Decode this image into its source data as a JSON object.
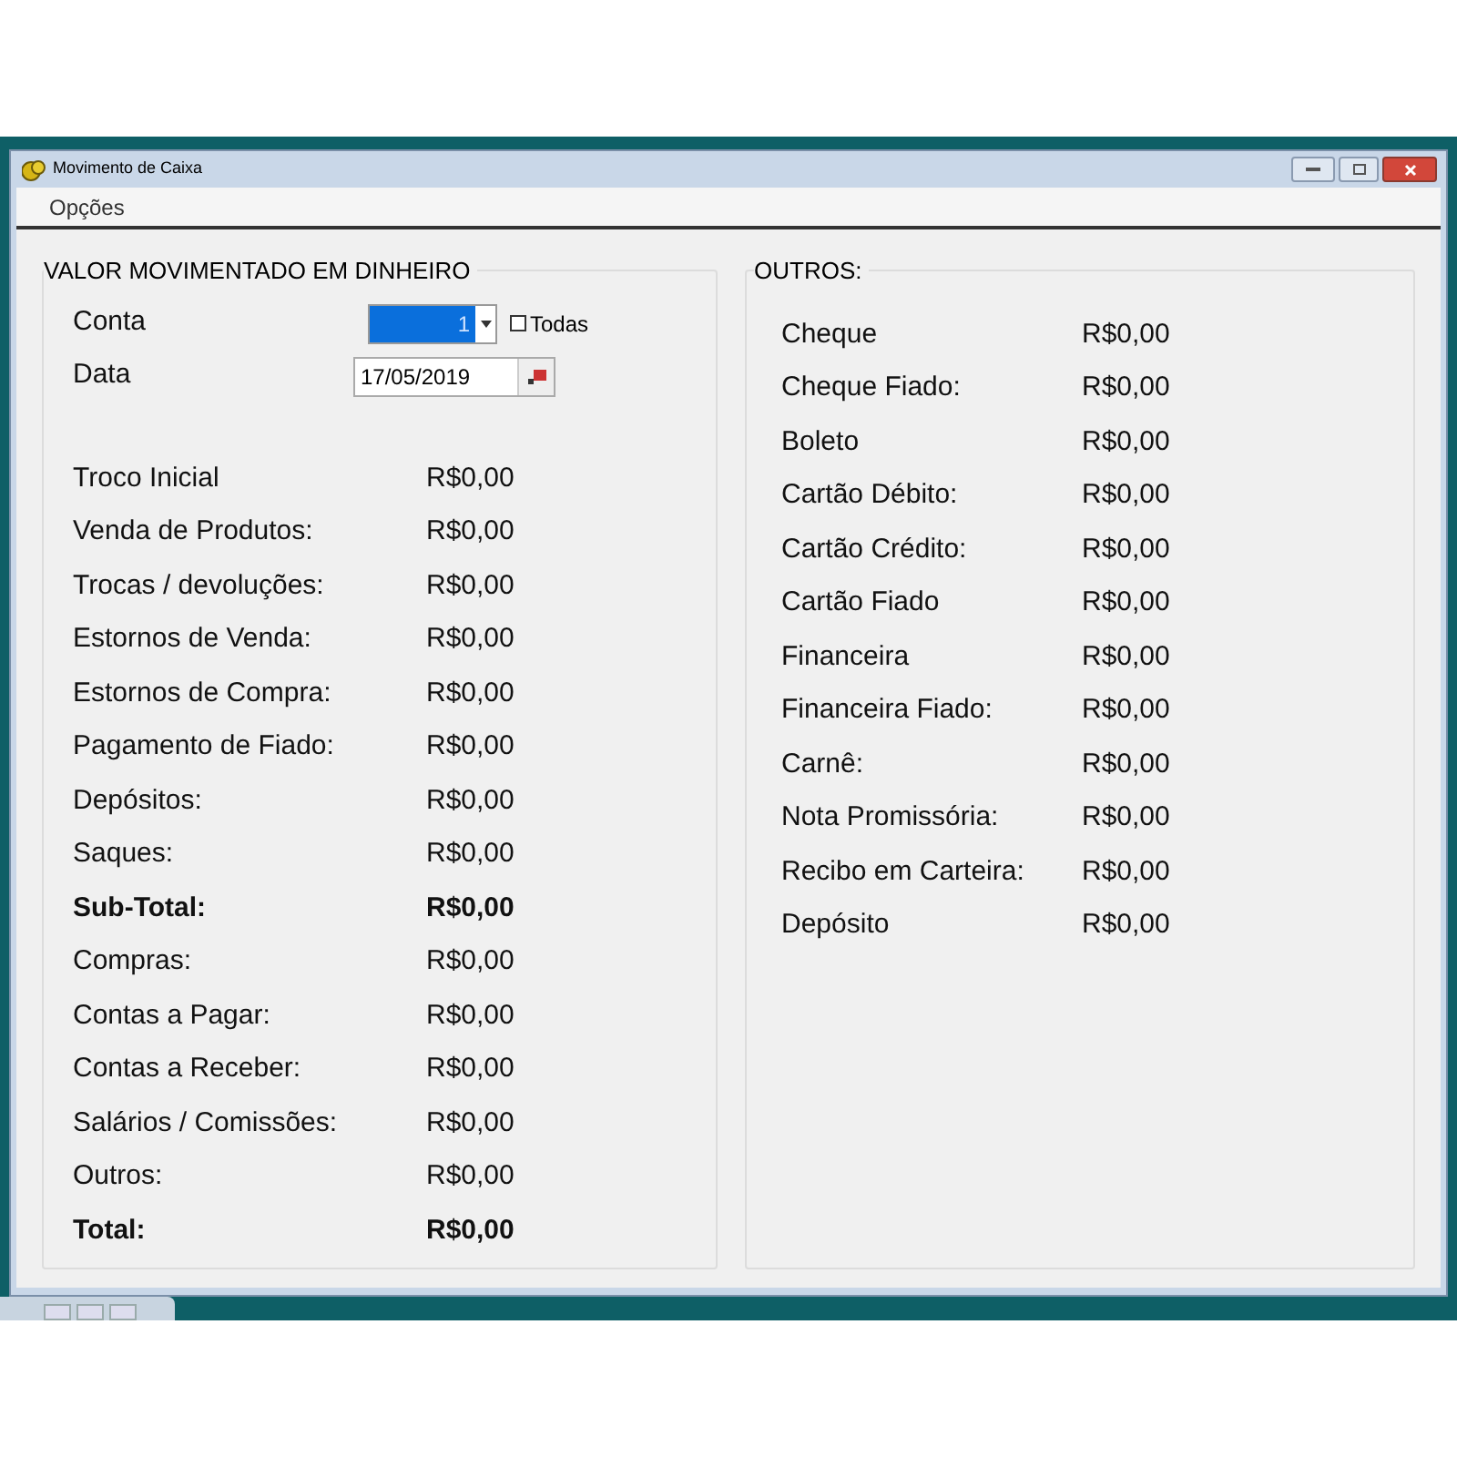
{
  "window": {
    "title": "Movimento de Caixa"
  },
  "menu": [
    "Opções"
  ],
  "cash": {
    "title": "VALOR MOVIMENTADO EM DINHEIRO",
    "account": {
      "label": "Conta",
      "value": "1",
      "all_label": "Todas",
      "all_checked": false
    },
    "date": {
      "label": "Data",
      "value": "17/05/2019"
    },
    "rows": [
      {
        "kind": "item",
        "label": "Troco Inicial",
        "value": "R$0,00"
      },
      {
        "kind": "item",
        "label": "Venda de Produtos:",
        "value": "R$0,00"
      },
      {
        "kind": "item",
        "label": "Trocas / devoluções:",
        "value": "R$0,00"
      },
      {
        "kind": "item",
        "label": "Estornos de Venda:",
        "value": "R$0,00"
      },
      {
        "kind": "item",
        "label": "Estornos de Compra:",
        "value": "R$0,00"
      },
      {
        "kind": "item",
        "label": "Pagamento de Fiado:",
        "value": "R$0,00"
      },
      {
        "kind": "item",
        "label": "Depósitos:",
        "value": "R$0,00"
      },
      {
        "kind": "item",
        "label": "Saques:",
        "value": "R$0,00"
      },
      {
        "kind": "total",
        "label": "Sub-Total:",
        "value": "R$0,00"
      },
      {
        "kind": "item",
        "label": "Compras:",
        "value": "R$0,00"
      },
      {
        "kind": "item",
        "label": "Contas a Pagar:",
        "value": "R$0,00"
      },
      {
        "kind": "item",
        "label": "Contas a Receber:",
        "value": "R$0,00"
      },
      {
        "kind": "item",
        "label": "Salários / Comissões:",
        "value": "R$0,00"
      },
      {
        "kind": "item",
        "label": "Outros:",
        "value": "R$0,00"
      },
      {
        "kind": "total",
        "label": "Total:",
        "value": "R$0,00"
      }
    ]
  },
  "others": {
    "title": "OUTROS:",
    "rows": [
      {
        "label": "Cheque",
        "value": "R$0,00"
      },
      {
        "label": "Cheque Fiado:",
        "value": "R$0,00"
      },
      {
        "label": "Boleto",
        "value": "R$0,00"
      },
      {
        "label": "Cartão Débito:",
        "value": "R$0,00"
      },
      {
        "label": "Cartão Crédito:",
        "value": "R$0,00"
      },
      {
        "label": "Cartão Fiado",
        "value": "R$0,00"
      },
      {
        "label": "Financeira",
        "value": "R$0,00"
      },
      {
        "label": "Financeira Fiado:",
        "value": "R$0,00"
      },
      {
        "label": "Carnê:",
        "value": "R$0,00"
      },
      {
        "label": "Nota Promissória:",
        "value": "R$0,00"
      },
      {
        "label": "Recibo em Carteira:",
        "value": "R$0,00"
      },
      {
        "label": "Depósito",
        "value": "R$0,00"
      }
    ]
  }
}
